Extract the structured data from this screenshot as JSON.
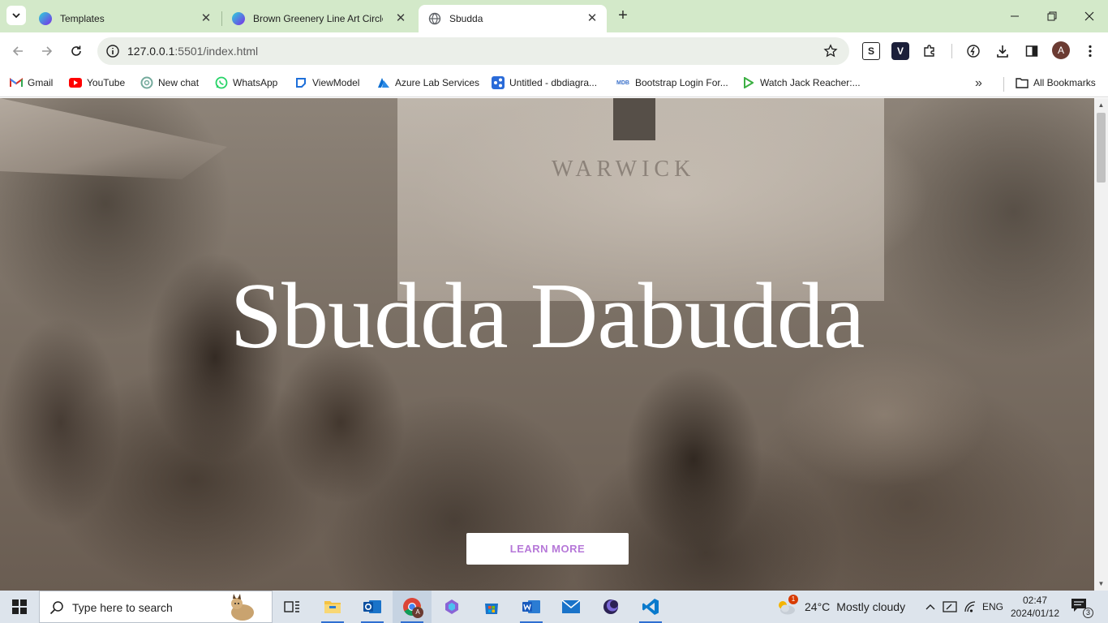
{
  "browser": {
    "tabs": [
      {
        "title": "Templates",
        "active": false
      },
      {
        "title": "Brown Greenery Line Art Circle",
        "active": false
      },
      {
        "title": "Sbudda",
        "active": true
      }
    ],
    "address": {
      "host": "127.0.0.1",
      "path": ":5501/index.html"
    },
    "bookmarks": [
      {
        "label": "Gmail",
        "icon": "gmail-icon"
      },
      {
        "label": "YouTube",
        "icon": "youtube-icon"
      },
      {
        "label": "New chat",
        "icon": "chatgpt-icon"
      },
      {
        "label": "WhatsApp",
        "icon": "whatsapp-icon"
      },
      {
        "label": "ViewModel",
        "icon": "viewmodel-icon"
      },
      {
        "label": "Azure Lab Services",
        "icon": "azure-icon"
      },
      {
        "label": "Untitled - dbdiagra...",
        "icon": "dbdiagram-icon"
      },
      {
        "label": "Bootstrap Login For...",
        "icon": "mdb-icon"
      },
      {
        "label": "Watch Jack Reacher:...",
        "icon": "play-icon"
      }
    ],
    "all_bookmarks": "All Bookmarks",
    "avatar_letter": "A",
    "ext_s": "S",
    "ext_v": "V",
    "mdb_text": "MDB"
  },
  "page": {
    "hero_title": "Sbudda Dabudda",
    "cta_label": "LEARN MORE",
    "cta_color": "#b678d8",
    "sign_text": "WARWICK"
  },
  "taskbar": {
    "search_placeholder": "Type here to search",
    "weather": {
      "temp": "24°C",
      "condition": "Mostly cloudy",
      "badge": "1"
    },
    "language": "ENG",
    "time": "02:47",
    "date": "2024/01/12",
    "notifications": "3",
    "chrome_avatar": "A"
  },
  "colors": {
    "tabstrip": "#d3e9c9",
    "accent_blue": "#2f6fd1"
  }
}
